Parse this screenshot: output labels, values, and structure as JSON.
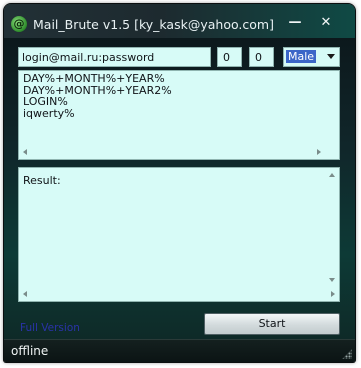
{
  "window": {
    "title": "Mail_Brute v1.5 [ky_kask@yahoo.com]",
    "minimize_label": "—",
    "close_label": "✕"
  },
  "inputs": {
    "login_value": "login@mail.ru:password",
    "field1_value": "0",
    "field2_value": "0",
    "sex_selected": "Male"
  },
  "password_list": [
    "DAY%+MONTH%+YEAR%",
    "DAY%+MONTH%+YEAR2%",
    "LOGIN%",
    "iqwerty%"
  ],
  "result": {
    "label": "Result:"
  },
  "footer": {
    "full_version_link": "Full Version",
    "start_button": "Start"
  },
  "status": {
    "text": "offline"
  },
  "colors": {
    "field_bg": "#d7fbf7",
    "link": "#2a33a8",
    "selected": "#3b66c8"
  }
}
